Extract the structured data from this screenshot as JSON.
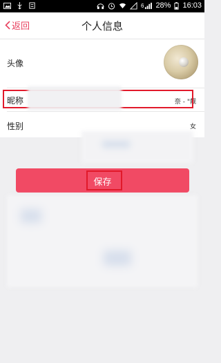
{
  "status_bar": {
    "signal": "6",
    "battery": "28%",
    "time": "16:03"
  },
  "nav": {
    "back_label": "返回",
    "title": "个人信息"
  },
  "profile": {
    "rows": [
      {
        "label": "头像",
        "value": ""
      },
      {
        "label": "昵称",
        "value": "奈 - \"靓"
      },
      {
        "label": "性别",
        "value": "女"
      }
    ]
  },
  "actions": {
    "save_label": "保存"
  },
  "colors": {
    "accent": "#f14a64",
    "highlight": "#e1192a"
  }
}
